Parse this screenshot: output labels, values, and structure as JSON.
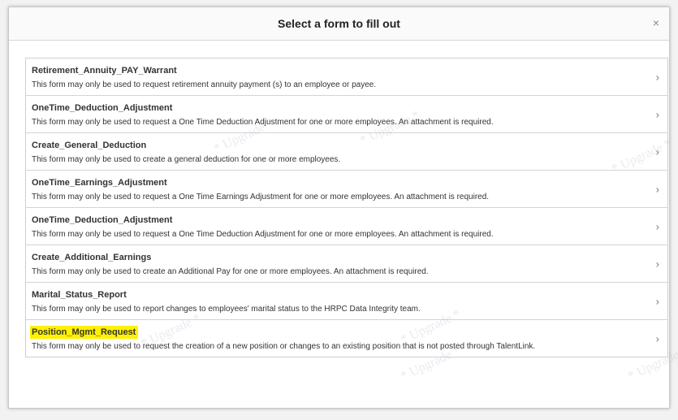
{
  "dialog": {
    "title": "Select a form to fill out",
    "close_label": "×"
  },
  "forms": [
    {
      "name": "Retirement_Annuity_PAY_Warrant",
      "description": "This form may only be used to request retirement annuity payment (s) to an employee or payee.",
      "highlighted": false
    },
    {
      "name": "OneTime_Deduction_Adjustment",
      "description": "This form may only be used to request a One Time Deduction Adjustment for one or more employees. An attachment is required.",
      "highlighted": false
    },
    {
      "name": "Create_General_Deduction",
      "description": "This form may only be used to create a general deduction for one or more employees.",
      "highlighted": false
    },
    {
      "name": "OneTime_Earnings_Adjustment",
      "description": "This form may only be used to request a One Time Earnings Adjustment for one or more employees. An attachment is required.",
      "highlighted": false
    },
    {
      "name": "OneTime_Deduction_Adjustment",
      "description": "This form may only be used to request a One Time Deduction Adjustment for one or more employees. An attachment is required.",
      "highlighted": false
    },
    {
      "name": "Create_Additional_Earnings",
      "description": "This form may only be used to create an Additional Pay for one or more employees. An attachment is required.",
      "highlighted": false
    },
    {
      "name": "Marital_Status_Report",
      "description": "This form may only be used to report changes to employees' marital status to the HRPC Data Integrity team.",
      "highlighted": false
    },
    {
      "name": "Position_Mgmt_Request",
      "description": "This form may only be used to request the creation of a new position or changes to an existing position that is not posted through TalentLink.",
      "highlighted": true
    }
  ],
  "chevron_glyph": "›",
  "watermark_text": "* Upgrade *",
  "colors": {
    "highlight": "#fff200",
    "border": "#cfcfcf",
    "text": "#333333"
  }
}
